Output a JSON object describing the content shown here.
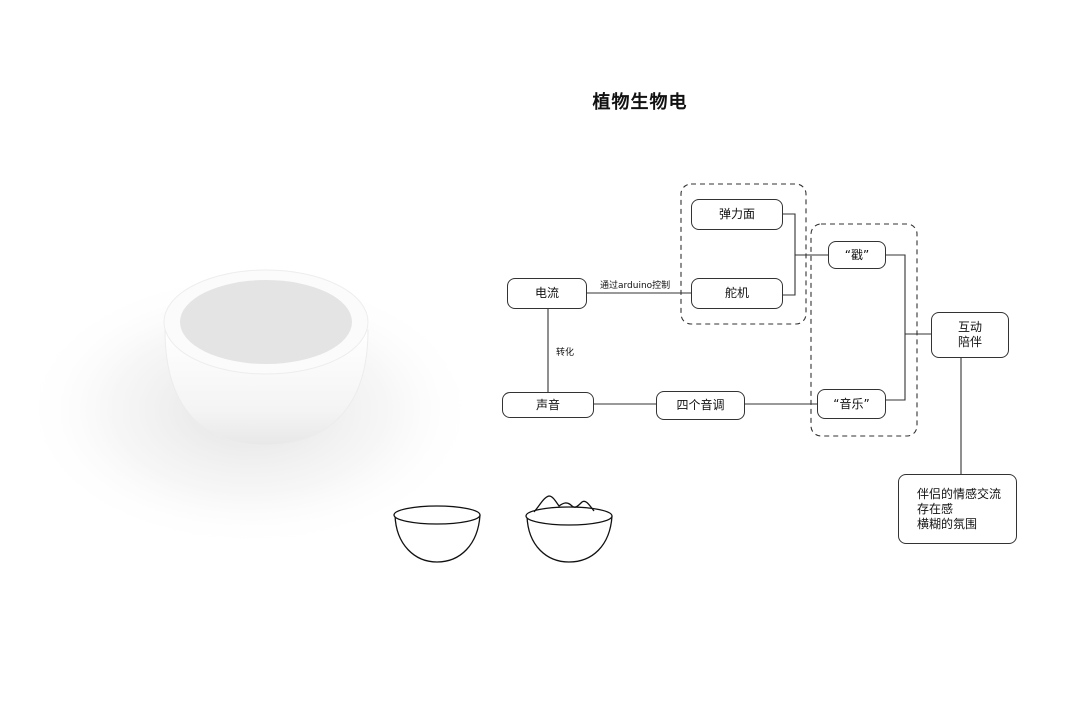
{
  "diagram": {
    "title": "植物生物电",
    "nodes": {
      "current": "电流",
      "spring_surface": "弹力面",
      "servo": "舵机",
      "poke": "“戳”",
      "interaction": [
        "互动",
        "陪伴"
      ],
      "sound": "声音",
      "four_tones": "四个音调",
      "music": "“音乐”",
      "feelings": [
        "伴侣的情感交流",
        "存在感",
        "横糊的氛围"
      ]
    },
    "edge_labels": {
      "current_to_servo": "通过arduino控制",
      "current_to_sound": "转化"
    }
  },
  "colors": {
    "line": "#333333",
    "bowl_body": "#f2f2f2",
    "bowl_rim": "#fafafa",
    "bowl_top": "#e6e6e6"
  }
}
